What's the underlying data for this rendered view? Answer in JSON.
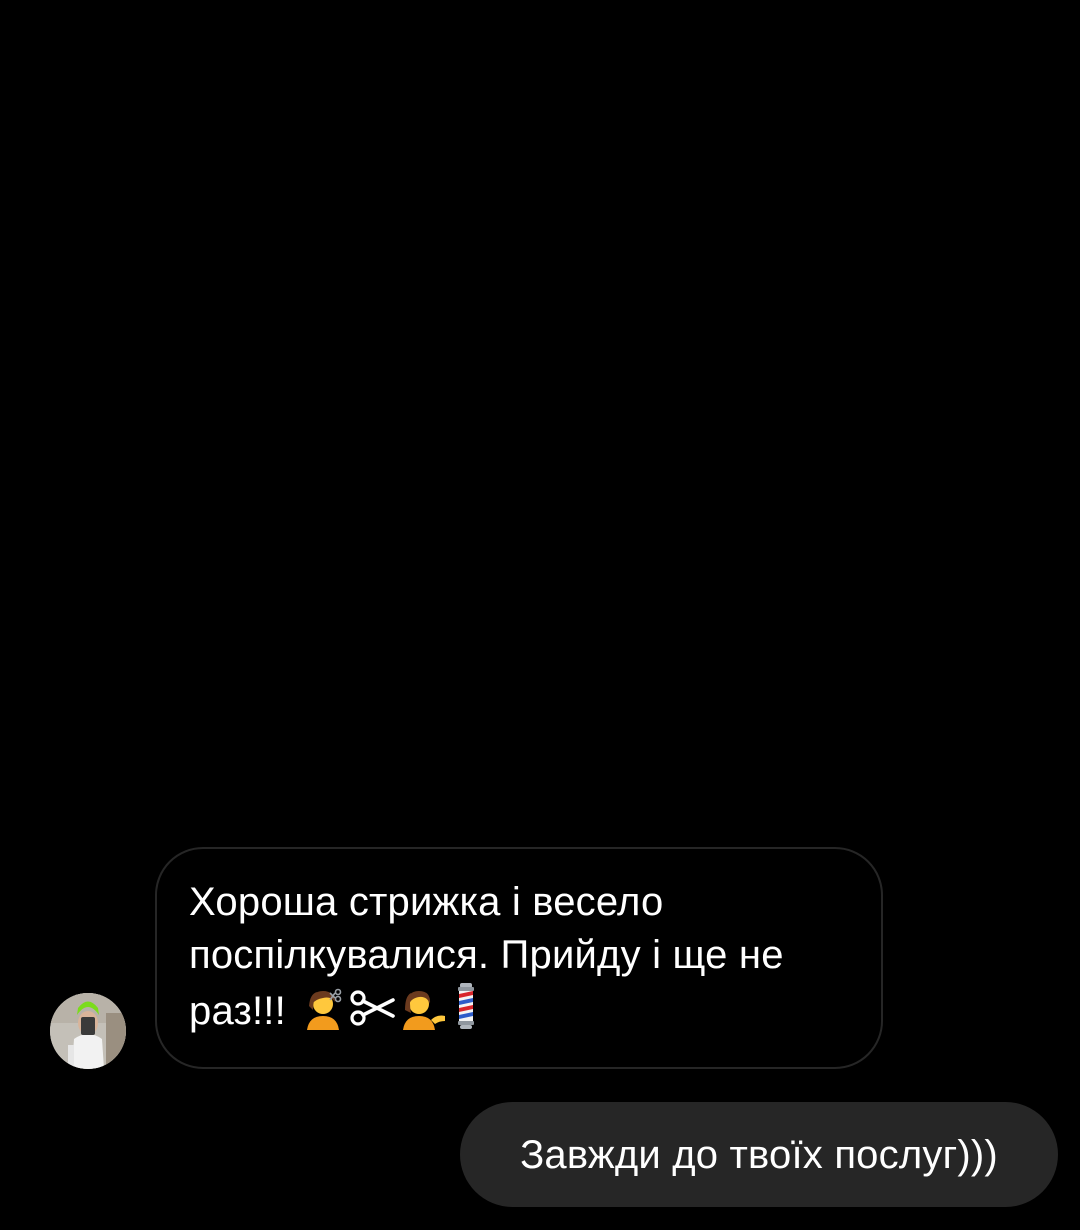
{
  "thread": {
    "incoming": {
      "text": "Хороша стрижка і весело поспілкувалися. Прийду і ще не раз!!!",
      "emojis": [
        "haircut-person-icon",
        "scissors-icon",
        "tipping-hand-person-icon",
        "barber-pole-icon"
      ]
    },
    "outgoing": {
      "text": "Завжди до твоїх послуг)))"
    }
  },
  "colors": {
    "background": "#000000",
    "incoming_bubble_border": "#262626",
    "outgoing_bubble": "#262626",
    "text": "#ffffff"
  }
}
